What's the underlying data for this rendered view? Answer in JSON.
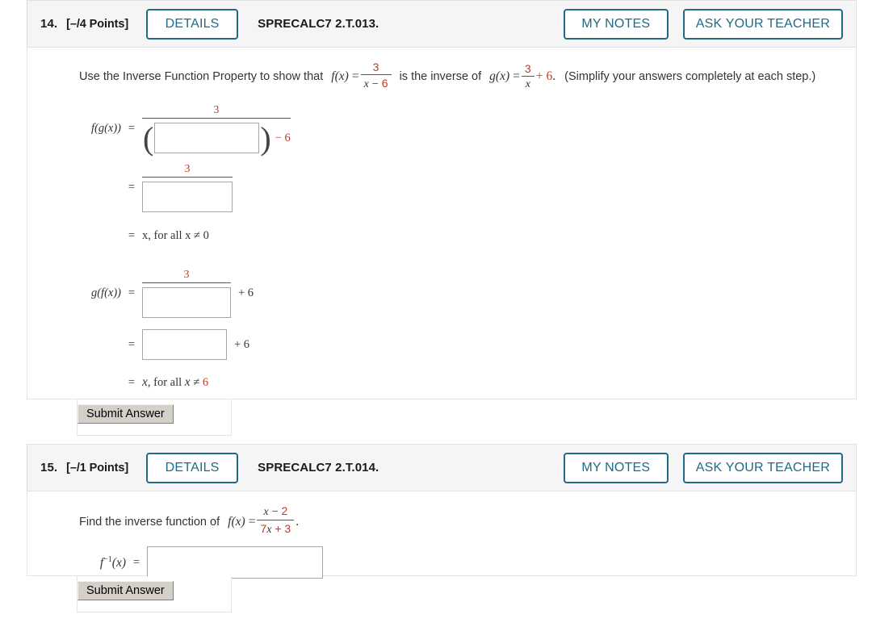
{
  "questions": [
    {
      "number": "14.",
      "points": "[–/4 Points]",
      "details_label": "DETAILS",
      "code": "SPRECALC7 2.T.013.",
      "my_notes_label": "MY NOTES",
      "ask_teacher_label": "ASK YOUR TEACHER",
      "prompt": {
        "part1": "Use the Inverse Function Property to show that",
        "fx_label": "f(x)",
        "eq1": "=",
        "f_num": "3",
        "f_den_var": "x",
        "f_den_op": "−",
        "f_den_num": "6",
        "part2": "is the inverse of",
        "gx_label": "g(x)",
        "eq2": "=",
        "g_num": "3",
        "g_den": "x",
        "g_plus": "+",
        "g_six": "6",
        "period": ".",
        "part3": "(Simplify your answers completely at each step.)"
      },
      "rows": [
        {
          "label": "f(g(x))",
          "eq": "=",
          "frac_numerator": "3",
          "open_paren": "(",
          "close_paren": ")",
          "input_value": "",
          "tail": "− 6",
          "tail_red": true
        },
        {
          "label": "",
          "eq": "=",
          "frac_numerator": "3",
          "input_value": "",
          "tail": ""
        },
        {
          "note_eq": "=",
          "note": "x, for all x ≠ 0",
          "note_last": "0"
        },
        {
          "label": "g(f(x))",
          "eq": "=",
          "frac_numerator": "3",
          "input_value": "",
          "tail": "+ 6",
          "tail_red": true
        },
        {
          "label": "",
          "eq": "=",
          "input_value": "",
          "tail": "+ 6",
          "tail_red": true
        },
        {
          "note_eq": "=",
          "note": "x, for all x ≠ 6",
          "note_last": "6"
        }
      ],
      "submit_label": "Submit Answer"
    },
    {
      "number": "15.",
      "points": "[–/1 Points]",
      "details_label": "DETAILS",
      "code": "SPRECALC7 2.T.014.",
      "my_notes_label": "MY NOTES",
      "ask_teacher_label": "ASK YOUR TEACHER",
      "prompt": {
        "part1": "Find the inverse function of",
        "fx_label": "f(x)",
        "eq1": "=",
        "num_var": "x",
        "num_op": "−",
        "num_val": "2",
        "den_coef": "7",
        "den_var": "x",
        "den_op": "+",
        "den_val": "3",
        "period": "."
      },
      "answer_label_f": "f",
      "answer_label_sup": "−1",
      "answer_label_x": "(x)",
      "answer_eq": "=",
      "input_value": "",
      "submit_label": "Submit Answer"
    }
  ],
  "colors": {
    "accent": "#1f6a85",
    "red": "#c0392b",
    "header_bg": "#f5f5f5",
    "text": "#333333"
  }
}
